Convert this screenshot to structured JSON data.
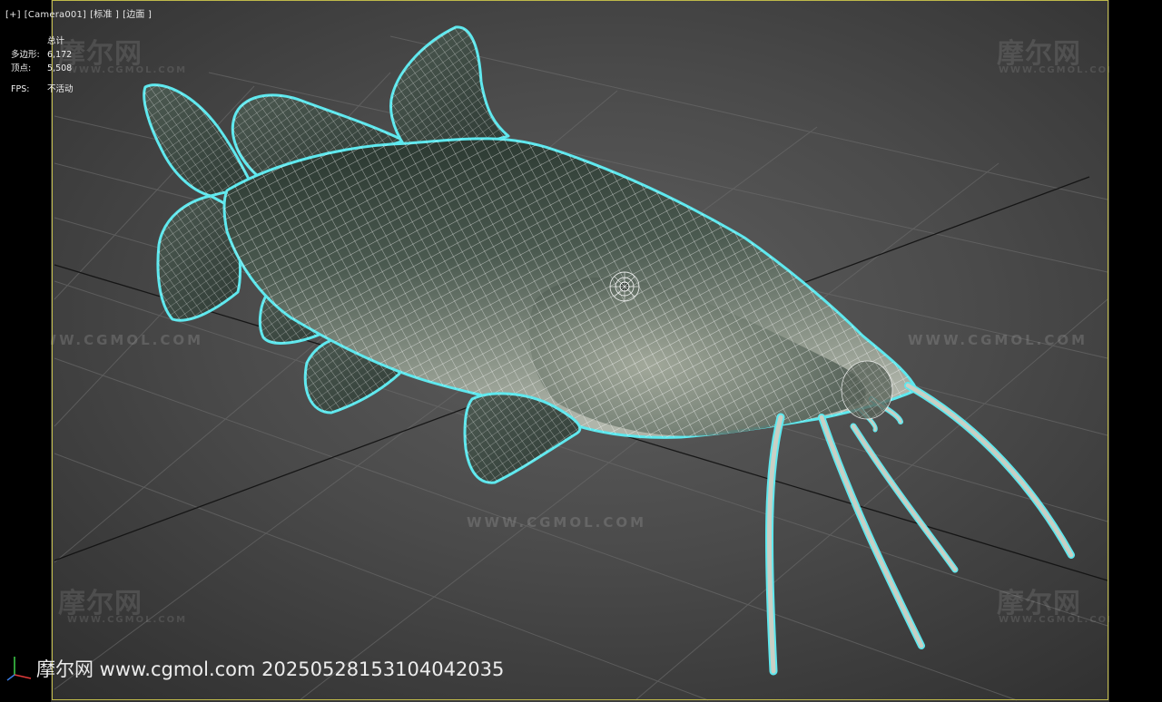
{
  "viewport": {
    "labels": [
      "[+]",
      "[Camera001]",
      "[标准 ]",
      "[边面 ]"
    ]
  },
  "stats": {
    "header": "总计",
    "rows": [
      {
        "label": "多边形:",
        "value": "6,172"
      },
      {
        "label": "顶点:",
        "value": "5,508"
      }
    ],
    "fps_label": "FPS:",
    "fps_value": "不活动"
  },
  "watermarks": {
    "cn": "摩尔网",
    "en": "WWW.CGMOL.COM",
    "url": "WWW.CGMOL.COM"
  },
  "footer": {
    "text": "摩尔网 www.cgmol.com 20250528153104042035"
  },
  "colors": {
    "wireframe_outline": "#5ee8ee",
    "wire": "#ffffff",
    "grid": "#6a6a6a",
    "safe_frame": "#bfb94a",
    "body_dark": "#36443c",
    "body_light": "#9aa294"
  },
  "icons": {
    "axis_gizmo": "axis-gizmo-icon",
    "model": "catfish-wireframe-model"
  }
}
